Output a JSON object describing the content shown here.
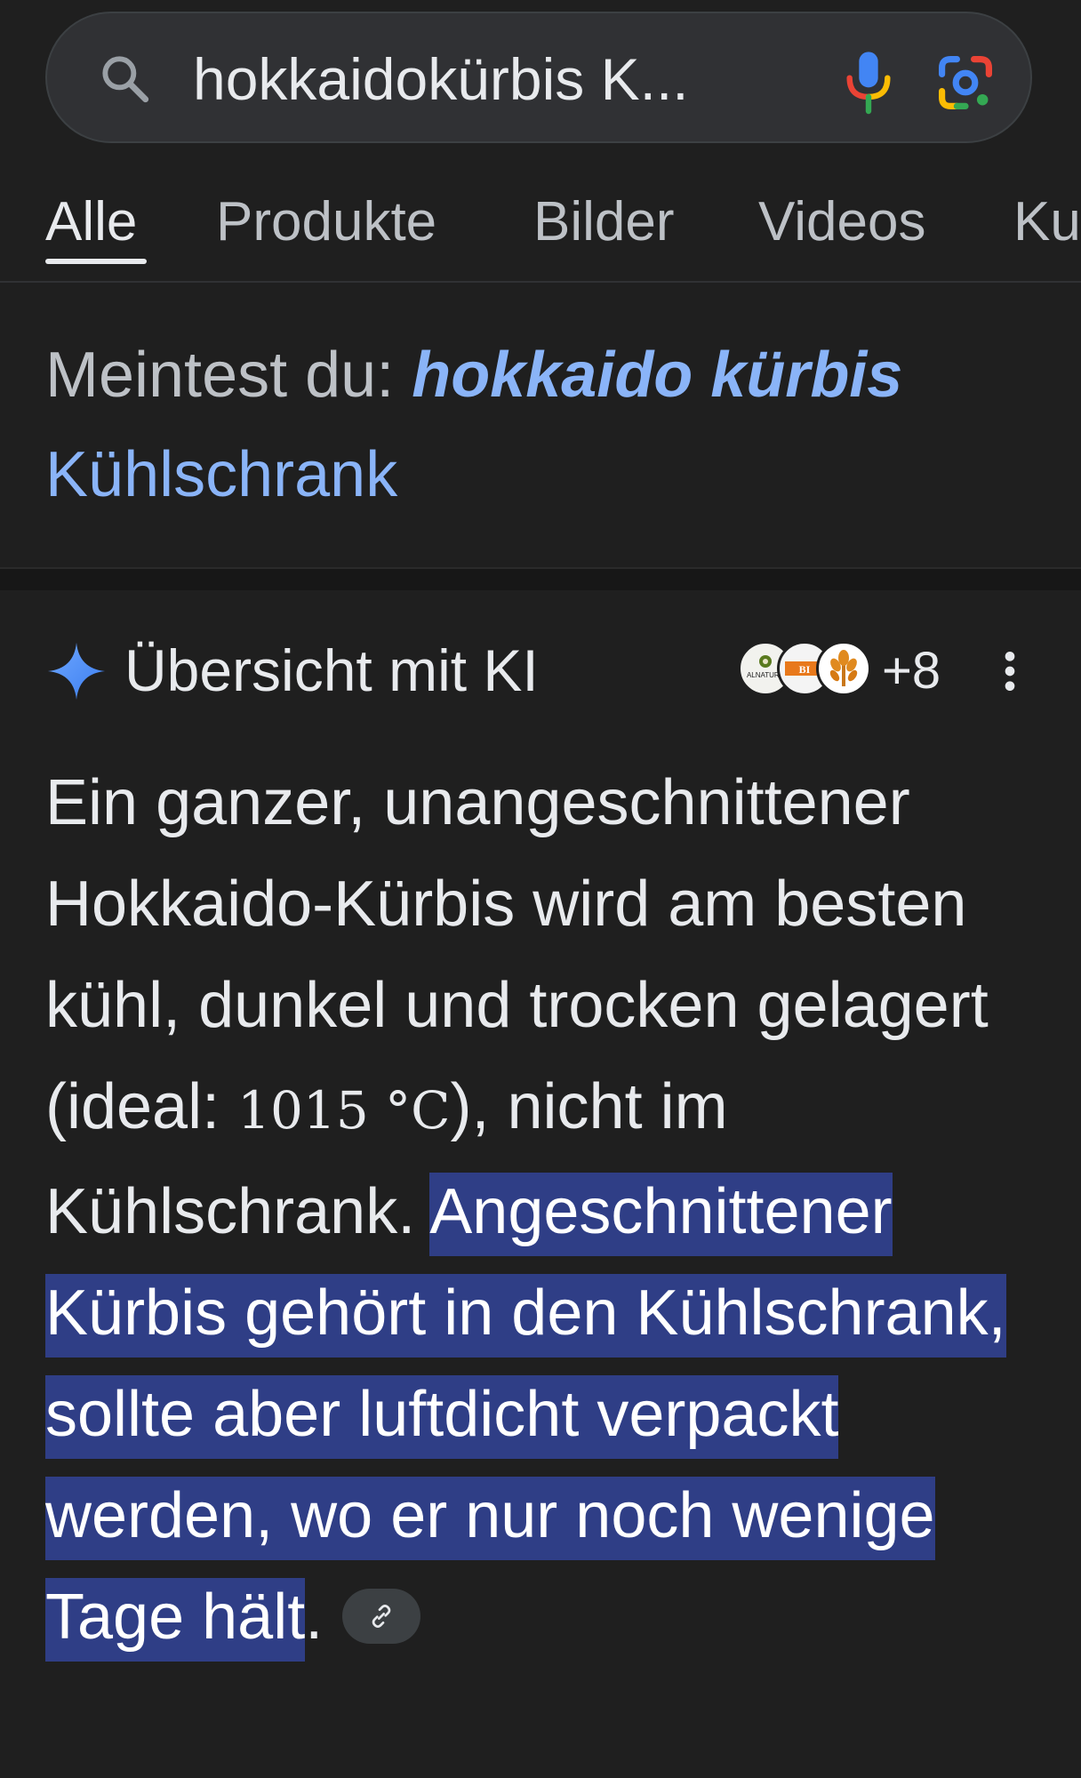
{
  "search": {
    "query": "hokkaidokürbis K..."
  },
  "tabs": [
    {
      "label": "Alle",
      "active": true
    },
    {
      "label": "Produkte",
      "active": false
    },
    {
      "label": "Bilder",
      "active": false
    },
    {
      "label": "Videos",
      "active": false
    },
    {
      "label": "Ku",
      "active": false
    }
  ],
  "did_you_mean": {
    "prefix": "Meintest du:",
    "suggestion_bold": "hokkaido kürbis",
    "suggestion_rest": "Kühlschrank"
  },
  "ai_overview": {
    "title": "Übersicht mit KI",
    "source_count": "+8",
    "sources": [
      {
        "name": "ALNATURA"
      },
      {
        "name": "BI"
      },
      {
        "name": "wheat"
      }
    ],
    "text_part1": "Ein ganzer, unangeschnittener Hokkaido-Kürbis wird am besten kühl, dunkel und trocken gelagert (ideal: ",
    "temperature": "1015 °C",
    "text_part2": "), nicht im Kühlschrank. ",
    "highlight": "Angeschnittener Kürbis gehört in den Kühlschrank, sollte aber luftdicht verpackt werden, wo er nur noch wenige Tage hält",
    "text_end": "."
  },
  "colors": {
    "background": "#1f1f1f",
    "link": "#8ab4f8",
    "highlight": "#2f3e86",
    "sparkle": "#4c8df6"
  },
  "icons": {
    "search": "search-icon",
    "mic": "mic-icon",
    "lens": "google-lens-icon",
    "sparkle": "sparkle-icon",
    "more": "more-vert-icon",
    "link": "link-icon"
  }
}
